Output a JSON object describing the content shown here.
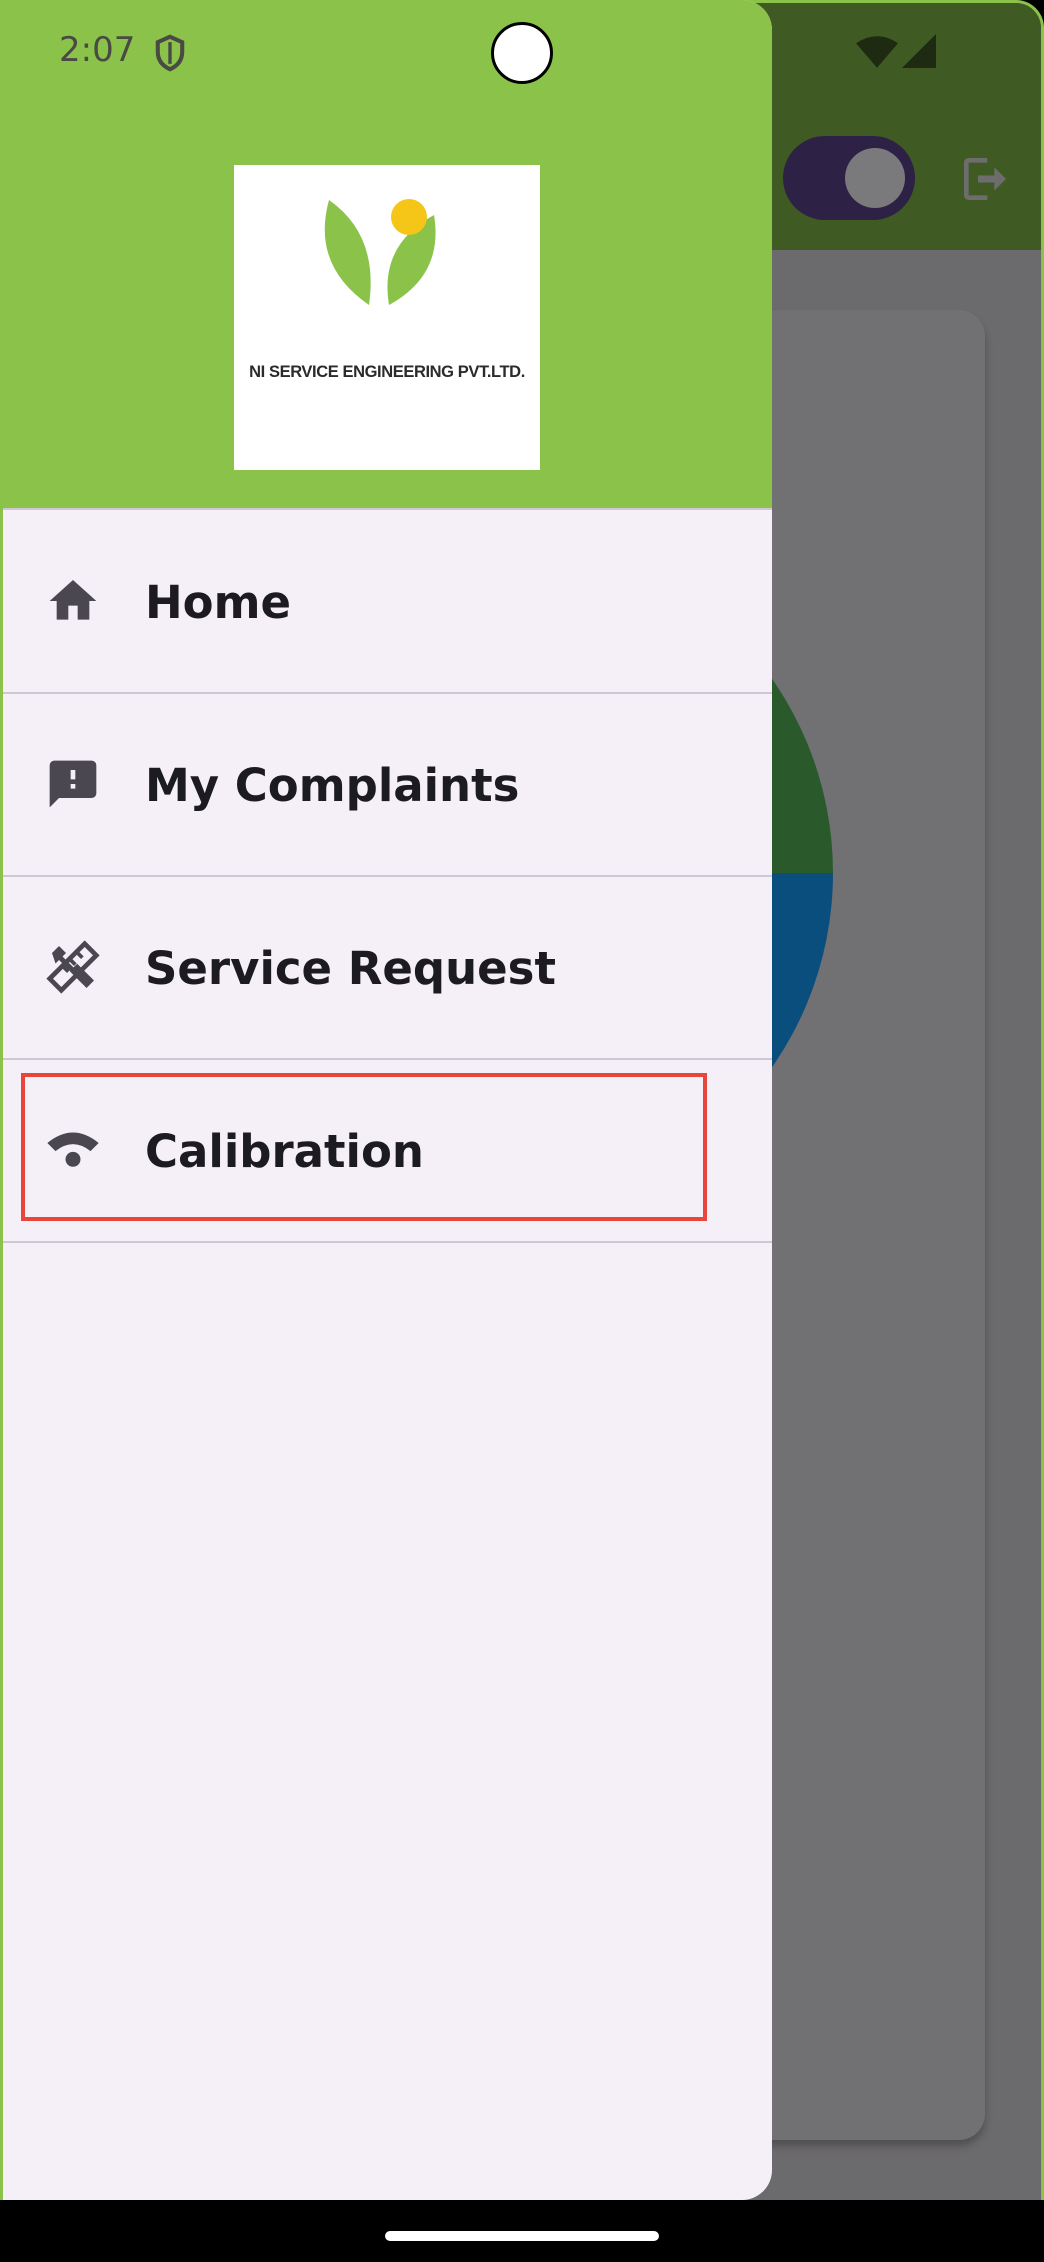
{
  "status_bar": {
    "time": "2:07",
    "icons": [
      "shield-icon",
      "wifi-icon",
      "signal-icon"
    ]
  },
  "background_app": {
    "toggle_state": "on",
    "logout_icon": "logout-icon"
  },
  "drawer": {
    "logo": {
      "company_name": "NI SERVICE ENGINEERING PVT.LTD."
    },
    "items": [
      {
        "label": "Home",
        "icon": "home-icon"
      },
      {
        "label": "My Complaints",
        "icon": "feedback-icon"
      },
      {
        "label": "Service Request",
        "icon": "tools-icon"
      },
      {
        "label": "Calibration",
        "icon": "calibration-icon",
        "highlighted": true
      }
    ]
  },
  "colors": {
    "brand_green": "#8bc34a",
    "drawer_background": "#f5f0f7",
    "highlight_red": "#e8453c",
    "scrim_topbar": "#3f5a22"
  }
}
